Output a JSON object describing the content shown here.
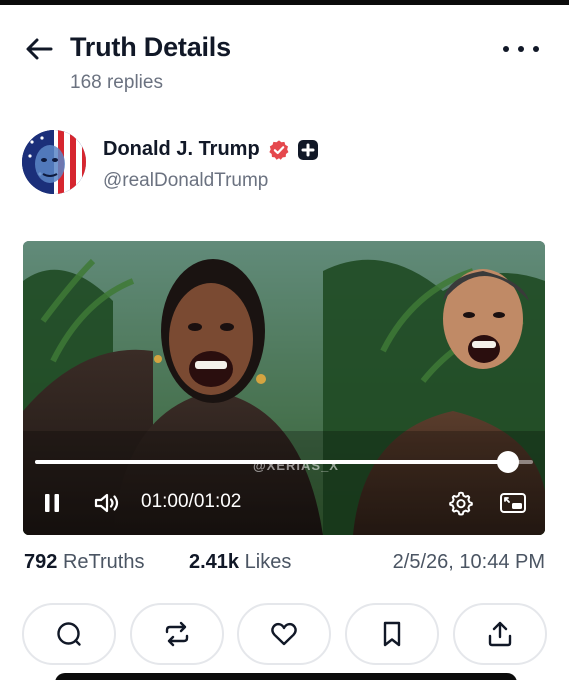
{
  "header": {
    "title": "Truth Details",
    "subtitle": "168 replies"
  },
  "author": {
    "name": "Donald J. Trump",
    "handle": "@realDonaldTrump"
  },
  "video": {
    "watermark": "@XERIAS_X",
    "current_time": "01:00",
    "duration": "01:02",
    "time_separator": "/",
    "progress": 0.95
  },
  "stats": {
    "retruths_count": "792",
    "retruths_label": "ReTruths",
    "likes_count": "2.41k",
    "likes_label": "Likes",
    "date": "2/5/26, 10:44 PM"
  },
  "colors": {
    "verified_badge": "#e5484d",
    "text_primary": "#111827",
    "text_secondary": "#6b7280"
  },
  "icons": {
    "back": "arrow-left-icon",
    "more": "more-horizontal-icon",
    "verified": "verified-badge-icon",
    "plus": "plus-badge-icon",
    "pause": "pause-icon",
    "volume": "volume-icon",
    "settings": "settings-gear-icon",
    "pip": "picture-in-picture-icon",
    "reply": "reply-icon",
    "retruth": "retruth-icon",
    "like": "heart-icon",
    "bookmark": "bookmark-icon",
    "share": "share-icon"
  }
}
